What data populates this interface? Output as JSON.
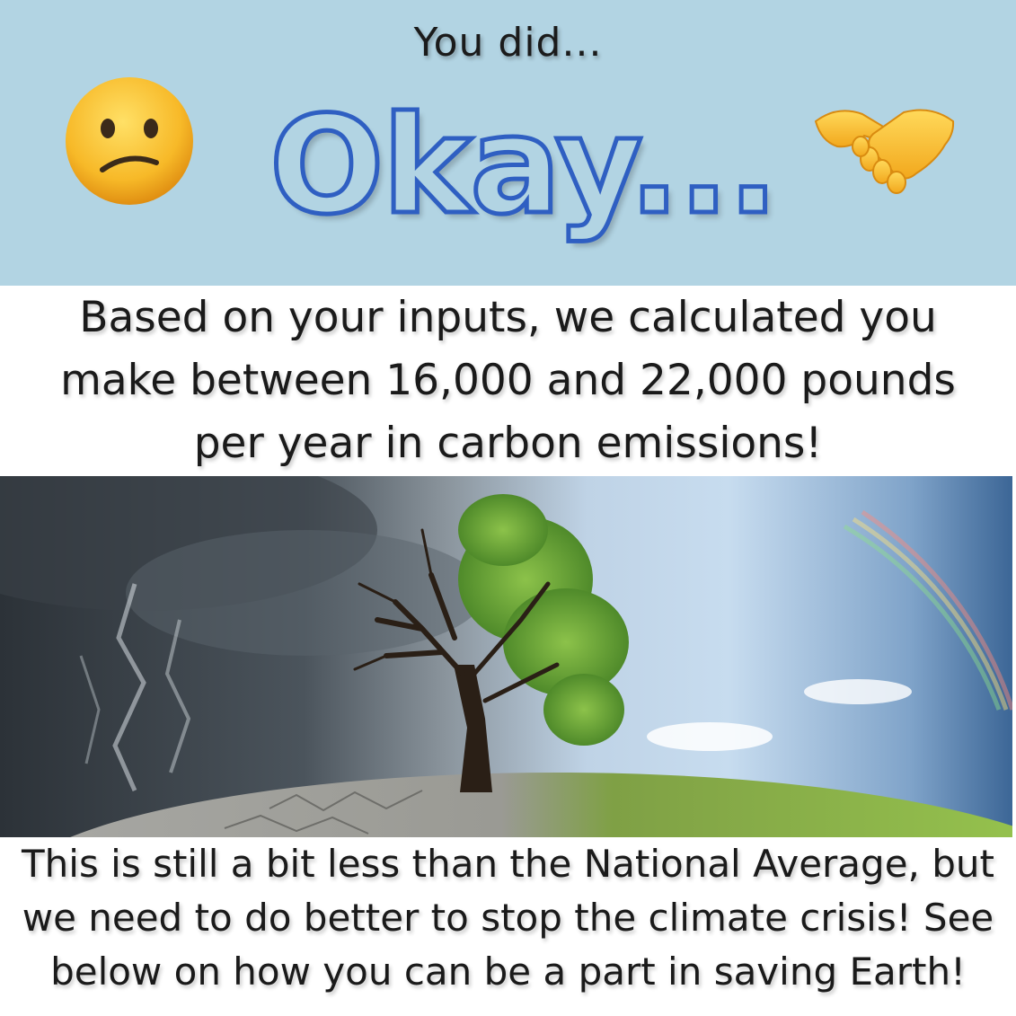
{
  "header": {
    "subtitle": "You did...",
    "headline": "Okay...",
    "left_emoji": "confused-face-icon",
    "right_emoji": "handshake-icon",
    "panel_color": "#b2d4e3",
    "headline_outline_color": "#2f5fc2"
  },
  "result": {
    "text": "Based on your inputs, we calculated you make between 16,000 and 22,000 pounds per year in carbon emissions!"
  },
  "image": {
    "subject": "climate-contrast-tree-icon"
  },
  "footer": {
    "text": "This is still a bit less than the National Average, but we need to do better to stop the climate crisis! See below on how you can be a part in saving Earth!"
  }
}
